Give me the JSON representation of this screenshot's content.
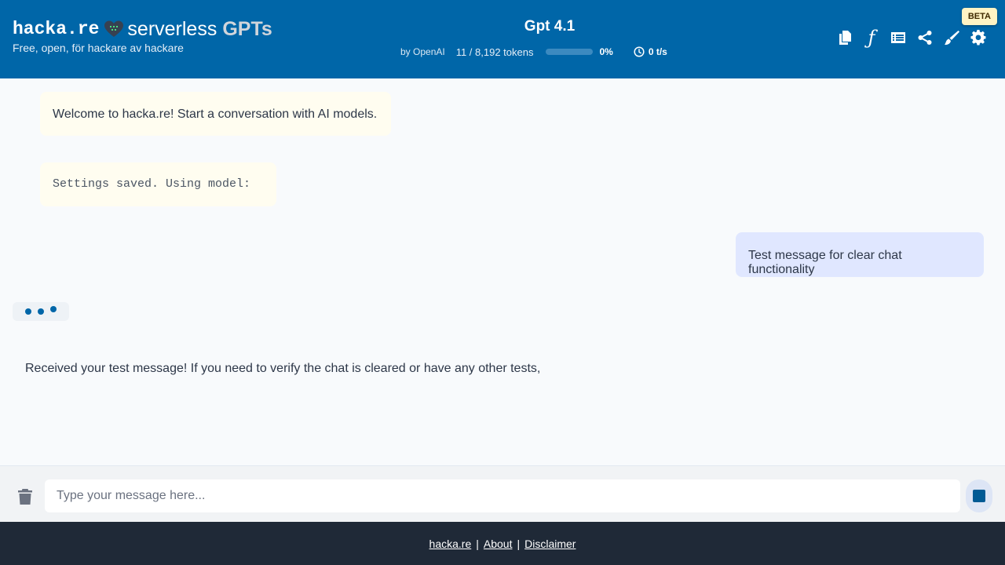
{
  "header": {
    "brand_name": "hacka.re",
    "brand_product": "serverless",
    "brand_gpts": "GPTs",
    "tagline": "Free, open, för hackare av hackare",
    "model_title": "Gpt 4.1",
    "model_by": "by OpenAI",
    "token_usage": "11 / 8,192 tokens",
    "context_percent_label": "0%",
    "context_percent_value": 0,
    "tokens_per_second": "0 t/s",
    "beta_label": "BETA",
    "toolbar_icons": [
      "copy-icon",
      "function-icon",
      "list-icon",
      "share-icon",
      "brush-icon",
      "gear-icon"
    ],
    "accent_color": "#0066a8"
  },
  "messages": {
    "system_welcome": "Welcome to hacka.re! Start a conversation with AI models.",
    "system_settings": "Settings saved. Using model:",
    "user_message": "Test message for clear chat functionality",
    "assistant_message": "Received your test message! If you need to verify the chat is cleared or have any other tests,"
  },
  "input": {
    "placeholder": "Type your message here..."
  },
  "footer": {
    "home_link": "hacka.re",
    "about_link": "About",
    "disclaimer_link": "Disclaimer",
    "separator": "|"
  }
}
